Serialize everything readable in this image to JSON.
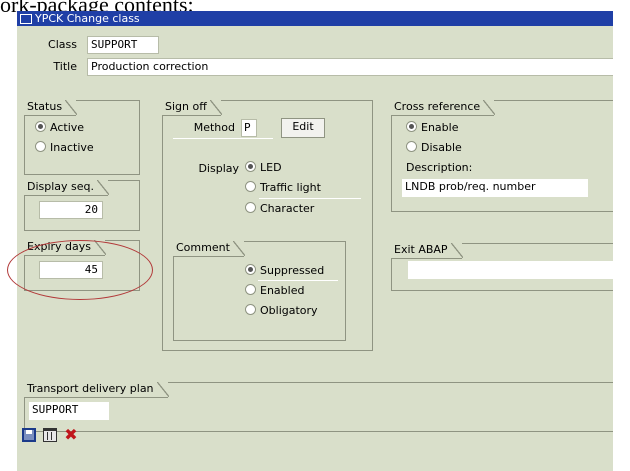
{
  "page_header_clipped": "ork-package contents:",
  "window": {
    "title": "YPCK Change class"
  },
  "header_fields": {
    "class_label": "Class",
    "class_value": "SUPPORT",
    "title_label": "Title",
    "title_value": "Production correction"
  },
  "status": {
    "title": "Status",
    "options": [
      "Active",
      "Inactive"
    ],
    "selected": "Active"
  },
  "display_seq": {
    "title": "Display seq.",
    "value": "20"
  },
  "expiry_days": {
    "title": "Expiry days",
    "value": "45"
  },
  "sign_off": {
    "title": "Sign off",
    "method_label": "Method",
    "method_value": "P",
    "edit_button": "Edit",
    "display_label": "Display",
    "display_options": [
      "LED",
      "Traffic light",
      "Character"
    ],
    "display_selected": "LED"
  },
  "comment": {
    "title": "Comment",
    "options": [
      "Suppressed",
      "Enabled",
      "Obligatory"
    ],
    "selected": "Suppressed"
  },
  "cross_reference": {
    "title": "Cross reference",
    "options": [
      "Enable",
      "Disable"
    ],
    "selected": "Enable",
    "description_label": "Description:",
    "description_value": "LNDB prob/req. number"
  },
  "exit_abap": {
    "title": "Exit ABAP",
    "value": ""
  },
  "transport": {
    "title": "Transport delivery plan",
    "value": "SUPPORT"
  },
  "toolbar": {
    "icons": [
      "save-icon",
      "delete-icon",
      "cancel-icon"
    ]
  },
  "colors": {
    "window_bg": "#d9dfca",
    "titlebar": "#1f3fa6",
    "annotation": "#b23a3a"
  }
}
